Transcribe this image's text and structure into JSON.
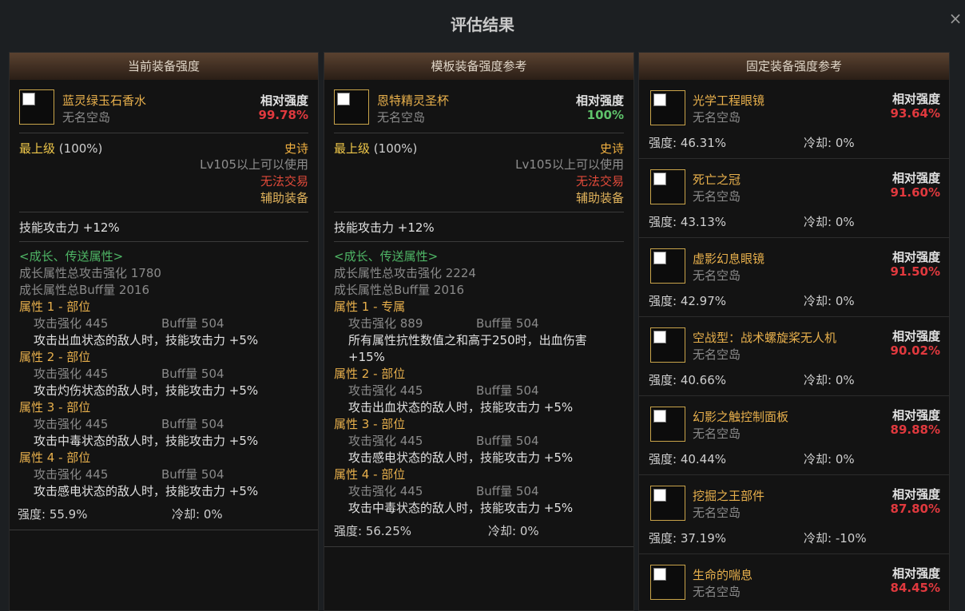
{
  "title": "评估结果",
  "close_icon": "×",
  "panels": {
    "current": {
      "header": "当前装备强度",
      "item_name": "蓝灵绿玉石香水",
      "item_source": "无名空岛",
      "rel_label": "相对强度",
      "rel_value": "99.78%",
      "grade": "最上级",
      "grade_pct": "(100%)",
      "rarity": "史诗",
      "level_req": "Lv105以上可以使用",
      "trade": "无法交易",
      "slot": "辅助装备",
      "skill": "技能攻击力   +12%",
      "growth_head": "<成长、传送属性>",
      "growth_atk": "成长属性总攻击强化 1780",
      "growth_buff": "成长属性总Buff量 2016",
      "attrs": [
        {
          "title": "属性 1 - 部位",
          "atk": "攻击强化   445",
          "buff": "Buff量   504",
          "effect": "攻击出血状态的敌人时，技能攻击力 +5%"
        },
        {
          "title": "属性 2 - 部位",
          "atk": "攻击强化   445",
          "buff": "Buff量   504",
          "effect": "攻击灼伤状态的敌人时，技能攻击力 +5%"
        },
        {
          "title": "属性 3 - 部位",
          "atk": "攻击强化   445",
          "buff": "Buff量   504",
          "effect": "攻击中毒状态的敌人时，技能攻击力 +5%"
        },
        {
          "title": "属性 4 - 部位",
          "atk": "攻击强化   445",
          "buff": "Buff量   504",
          "effect": "攻击感电状态的敌人时，技能攻击力 +5%"
        }
      ],
      "strength": "强度: 55.9%",
      "cooldown": "冷却: 0%"
    },
    "template": {
      "header": "模板装备强度参考",
      "item_name": "恩特精灵圣杯",
      "item_source": "无名空岛",
      "rel_label": "相对强度",
      "rel_value": "100%",
      "grade": "最上级",
      "grade_pct": "(100%)",
      "rarity": "史诗",
      "level_req": "Lv105以上可以使用",
      "trade": "无法交易",
      "slot": "辅助装备",
      "skill": "技能攻击力   +12%",
      "growth_head": "<成长、传送属性>",
      "growth_atk": "成长属性总攻击强化 2224",
      "growth_buff": "成长属性总Buff量 2016",
      "attrs": [
        {
          "title": "属性 1 - 专属",
          "atk": "攻击强化   889",
          "buff": "Buff量   504",
          "effect": "所有属性抗性数值之和高于250时，出血伤害 +15%"
        },
        {
          "title": "属性 2 - 部位",
          "atk": "攻击强化   445",
          "buff": "Buff量   504",
          "effect": "攻击出血状态的敌人时，技能攻击力 +5%"
        },
        {
          "title": "属性 3 - 部位",
          "atk": "攻击强化   445",
          "buff": "Buff量   504",
          "effect": "攻击感电状态的敌人时，技能攻击力 +5%"
        },
        {
          "title": "属性 4 - 部位",
          "atk": "攻击强化   445",
          "buff": "Buff量   504",
          "effect": "攻击中毒状态的敌人时，技能攻击力 +5%"
        }
      ],
      "strength": "强度: 56.25%",
      "cooldown": "冷却: 0%"
    },
    "fixed": {
      "header": "固定装备强度参考",
      "cards": [
        {
          "name": "光学工程眼镜",
          "source": "无名空岛",
          "rel_label": "相对强度",
          "rel_value": "93.64%",
          "strength": "强度: 46.31%",
          "cooldown": "冷却: 0%"
        },
        {
          "name": "死亡之冠",
          "source": "无名空岛",
          "rel_label": "相对强度",
          "rel_value": "91.60%",
          "strength": "强度: 43.13%",
          "cooldown": "冷却: 0%"
        },
        {
          "name": "虚影幻息眼镜",
          "source": "无名空岛",
          "rel_label": "相对强度",
          "rel_value": "91.50%",
          "strength": "强度: 42.97%",
          "cooldown": "冷却: 0%"
        },
        {
          "name": "空战型：战术螺旋桨无人机",
          "source": "无名空岛",
          "rel_label": "相对强度",
          "rel_value": "90.02%",
          "strength": "强度: 40.66%",
          "cooldown": "冷却: 0%"
        },
        {
          "name": "幻影之触控制面板",
          "source": "无名空岛",
          "rel_label": "相对强度",
          "rel_value": "89.88%",
          "strength": "强度: 40.44%",
          "cooldown": "冷却: 0%"
        },
        {
          "name": "挖掘之王部件",
          "source": "无名空岛",
          "rel_label": "相对强度",
          "rel_value": "87.80%",
          "strength": "强度: 37.19%",
          "cooldown": "冷却: -10%"
        },
        {
          "name": "生命的喘息",
          "source": "无名空岛",
          "rel_label": "相对强度",
          "rel_value": "84.45%"
        }
      ]
    }
  },
  "colors": {
    "rel_red": "#e0393e",
    "rel_green": "#5ec26a",
    "gold": "#e8b04c",
    "header_gradient_top": "#5a4230"
  }
}
